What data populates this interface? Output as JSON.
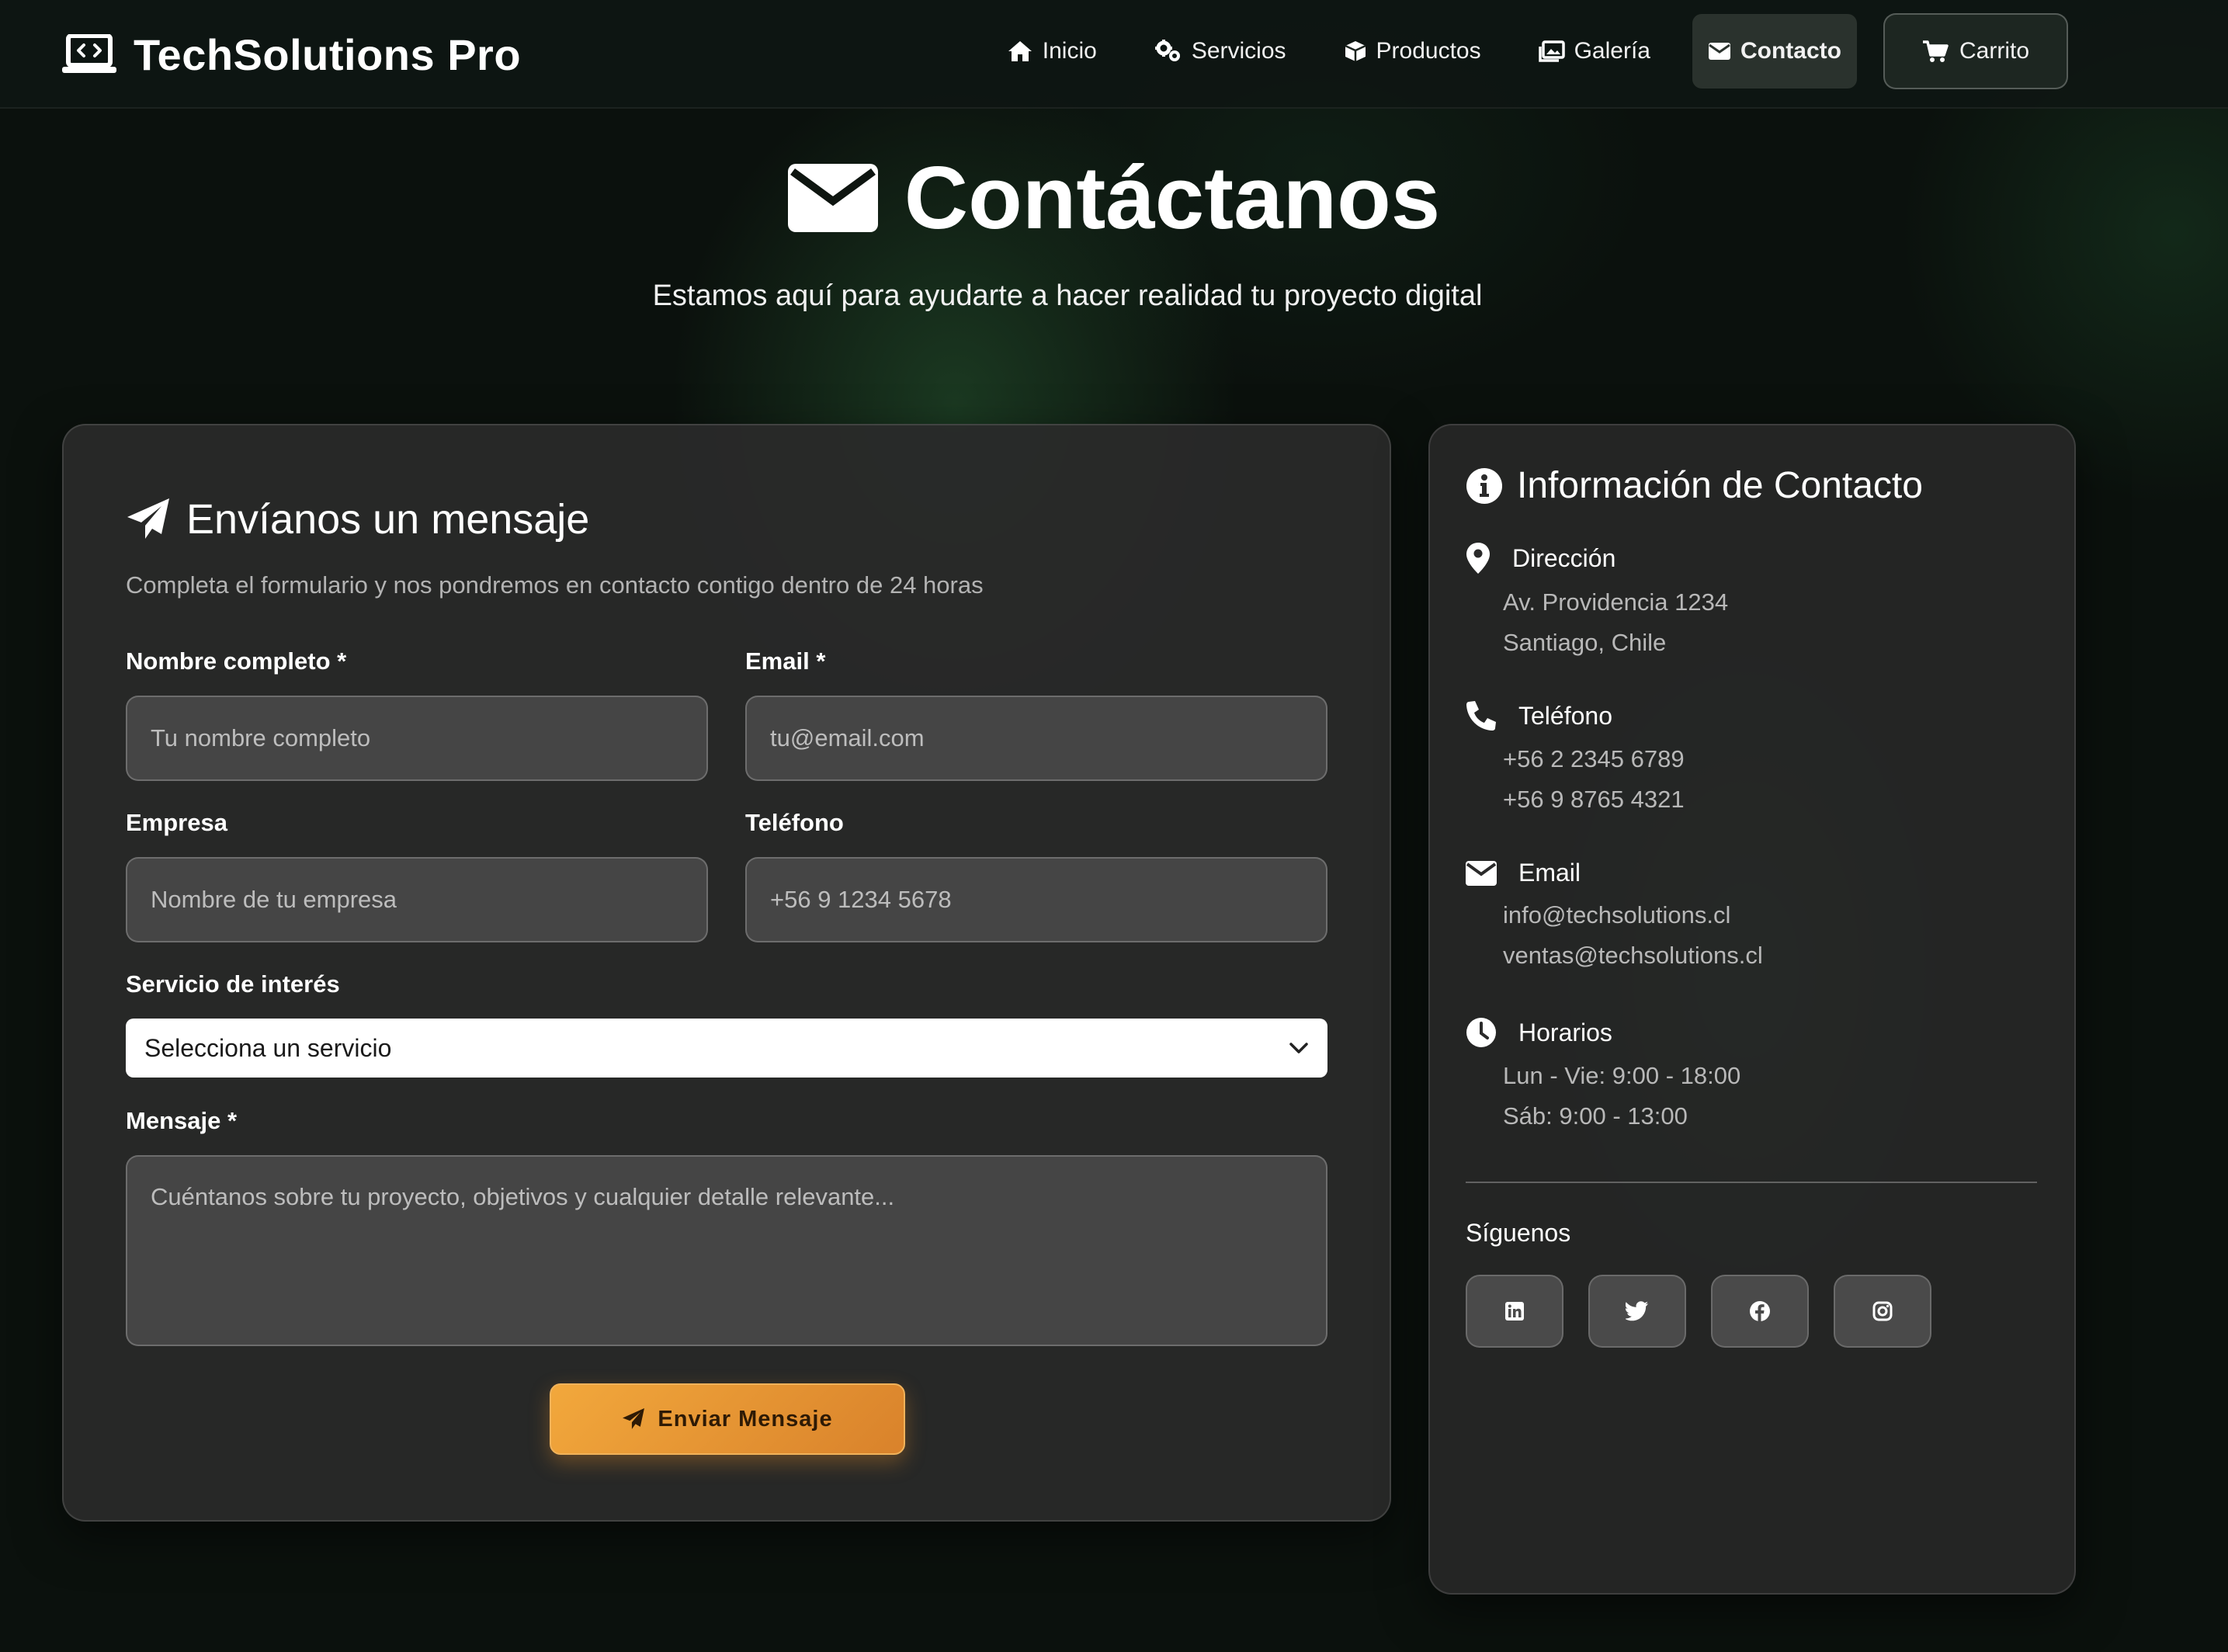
{
  "brand": {
    "name": "TechSolutions Pro",
    "icon": "laptop-code-icon"
  },
  "nav": {
    "links": [
      {
        "label": "Inicio",
        "icon": "home-icon"
      },
      {
        "label": "Servicios",
        "icon": "cogs-icon"
      },
      {
        "label": "Productos",
        "icon": "box-icon"
      },
      {
        "label": "Galería",
        "icon": "images-icon"
      },
      {
        "label": "Contacto",
        "icon": "envelope-icon",
        "active": true
      }
    ],
    "cart": {
      "label": "Carrito",
      "icon": "cart-icon"
    }
  },
  "hero": {
    "title": "Contáctanos",
    "subtitle": "Estamos aquí para ayudarte a hacer realidad tu proyecto digital"
  },
  "form": {
    "title": "Envíanos un mensaje",
    "description": "Completa el formulario y nos pondremos en contacto contigo dentro de 24 horas",
    "fields": {
      "name": {
        "label": "Nombre completo *",
        "placeholder": "Tu nombre completo"
      },
      "email": {
        "label": "Email *",
        "placeholder": "tu@email.com"
      },
      "company": {
        "label": "Empresa",
        "placeholder": "Nombre de tu empresa"
      },
      "phone": {
        "label": "Teléfono",
        "placeholder": "+56 9 1234 5678"
      },
      "service": {
        "label": "Servicio de interés",
        "selected": "Selecciona un servicio"
      },
      "message": {
        "label": "Mensaje *",
        "placeholder": "Cuéntanos sobre tu proyecto, objetivos y cualquier detalle relevante..."
      }
    },
    "submit_label": "Enviar Mensaje"
  },
  "info": {
    "title": "Información de Contacto",
    "address": {
      "title": "Dirección",
      "lines": [
        "Av. Providencia 1234",
        "Santiago, Chile"
      ]
    },
    "phone": {
      "title": "Teléfono",
      "lines": [
        "+56 2 2345 6789",
        "+56 9 8765 4321"
      ]
    },
    "email": {
      "title": "Email",
      "lines": [
        "info@techsolutions.cl",
        "ventas@techsolutions.cl"
      ]
    },
    "hours": {
      "title": "Horarios",
      "lines": [
        "Lun - Vie: 9:00 - 18:00",
        "Sáb: 9:00 - 13:00"
      ]
    },
    "follow_label": "Síguenos",
    "social": [
      "linkedin-icon",
      "twitter-icon",
      "facebook-icon",
      "instagram-icon"
    ]
  },
  "colors": {
    "accent": "#E8973A",
    "card": "#2A2A2A",
    "background": "#0B110D"
  }
}
